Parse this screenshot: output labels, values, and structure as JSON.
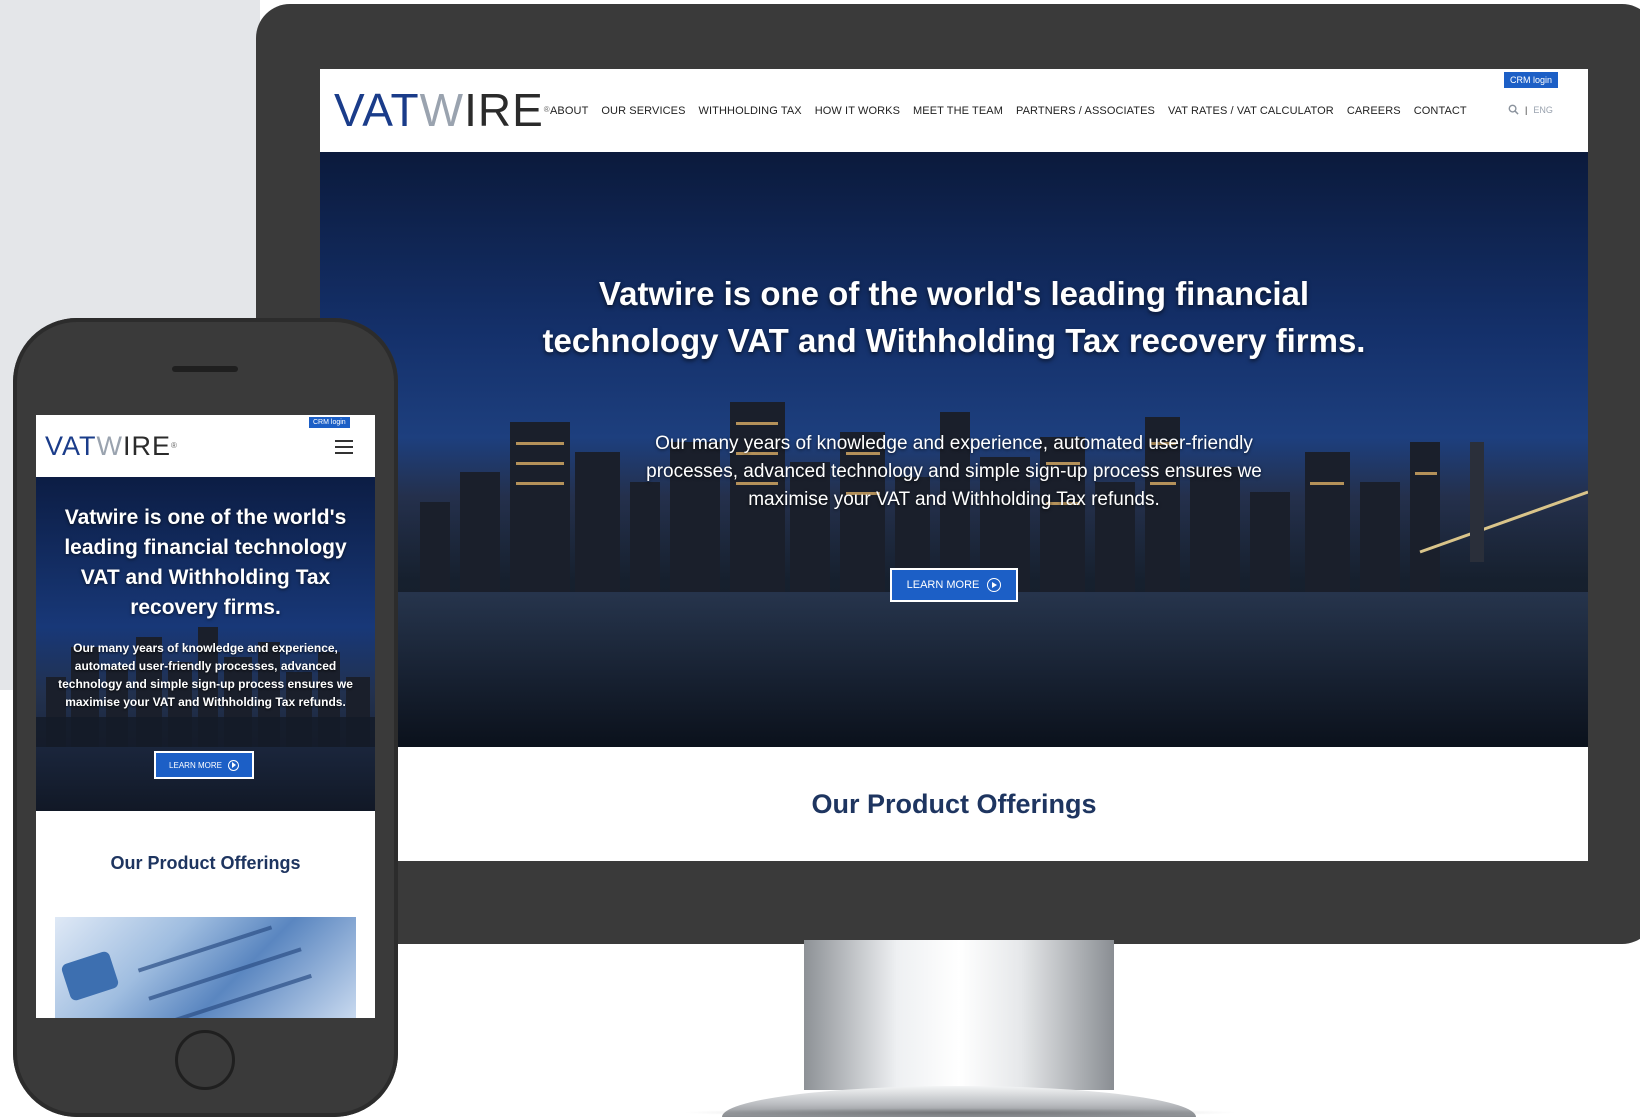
{
  "brand": {
    "logo_part1": "VAT",
    "logo_part2": "W",
    "logo_part3": "IRE",
    "registered": "®",
    "primary_color": "#1c5fc6",
    "navy_color": "#1e3560"
  },
  "desktop": {
    "crm_login": "CRM login",
    "nav": [
      "ABOUT",
      "OUR SERVICES",
      "WITHHOLDING TAX",
      "HOW IT WORKS",
      "MEET THE TEAM",
      "PARTNERS / ASSOCIATES",
      "VAT RATES / VAT CALCULATOR",
      "CAREERS",
      "CONTACT"
    ],
    "search_icon": "search-icon",
    "language_separator": "|",
    "language": "ENG",
    "hero_title": "Vatwire is one of the world's leading financial technology VAT and Withholding Tax recovery firms.",
    "hero_text": "Our many years of knowledge and experience, automated user-friendly processes, advanced technology and simple sign-up process ensures we maximise your VAT and Withholding Tax refunds.",
    "learn_more": "LEARN MORE",
    "offerings_title": "Our Product Offerings"
  },
  "mobile": {
    "crm_login": "CRM login",
    "menu_icon": "hamburger-icon",
    "hero_title": "Vatwire is one of the world's leading financial technology VAT and Withholding Tax recovery firms.",
    "hero_text": "Our many years of knowledge and experience, automated user-friendly processes, advanced technology and simple sign-up process ensures we maximise your VAT and Withholding Tax refunds.",
    "learn_more": "LEARN MORE",
    "offerings_title": "Our Product Offerings"
  }
}
